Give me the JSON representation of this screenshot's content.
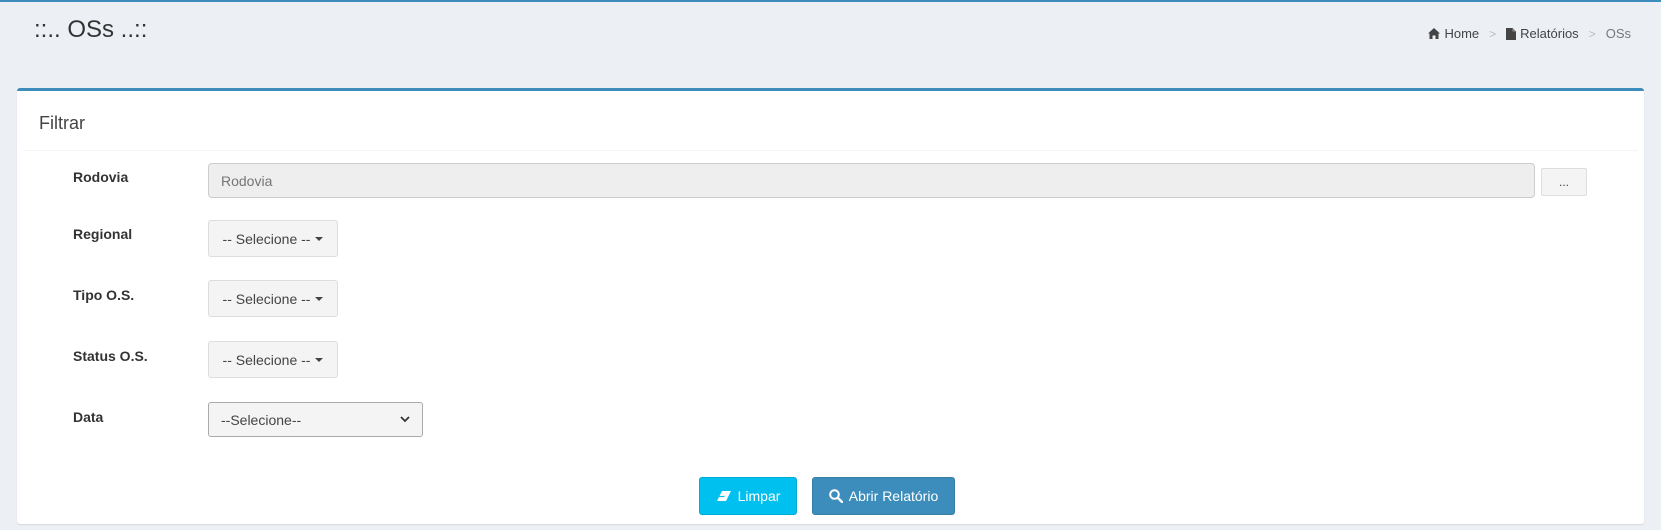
{
  "header": {
    "title": "::.. OSs ..::",
    "breadcrumb": [
      {
        "label": "Home",
        "icon": "home-icon"
      },
      {
        "label": "Relatórios",
        "icon": "file-icon"
      },
      {
        "label": "OSs"
      }
    ],
    "separator": ">"
  },
  "box": {
    "title": "Filtrar",
    "fields": {
      "rodovia": {
        "label": "Rodovia",
        "placeholder": "Rodovia",
        "lookup_button": "..."
      },
      "regional": {
        "label": "Regional",
        "value": "-- Selecione --"
      },
      "tipo_os": {
        "label": "Tipo O.S.",
        "value": "-- Selecione --"
      },
      "status_os": {
        "label": "Status O.S.",
        "value": "-- Selecione --"
      },
      "data": {
        "label": "Data",
        "value": "--Selecione--"
      }
    },
    "buttons": {
      "clear": {
        "label": "Limpar",
        "icon": "eraser-icon"
      },
      "open": {
        "label": "Abrir Relatório",
        "icon": "search-icon"
      }
    }
  },
  "colors": {
    "primary": "#3c8dbc",
    "info": "#00c0ef",
    "background": "#ecf0f5"
  }
}
